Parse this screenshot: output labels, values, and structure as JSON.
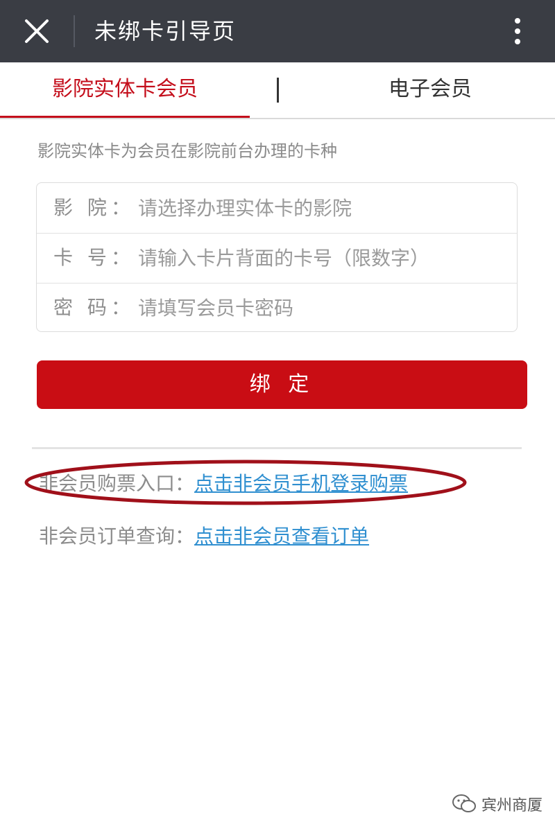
{
  "topbar": {
    "title": "未绑卡引导页",
    "close_icon": "close-icon",
    "more_icon": "more-vertical-icon"
  },
  "tabs": [
    {
      "label": "影院实体卡会员",
      "active": true
    },
    {
      "label": "电子会员",
      "active": false
    }
  ],
  "intro": "影院实体卡为会员在影院前台办理的卡种",
  "form": {
    "rows": [
      {
        "label": "影 院：",
        "placeholder": "请选择办理实体卡的影院"
      },
      {
        "label": "卡 号：",
        "placeholder": "请输入卡片背面的卡号（限数字）"
      },
      {
        "label": "密 码：",
        "placeholder": "请填写会员卡密码"
      }
    ]
  },
  "bind_button": "绑 定",
  "links": [
    {
      "prefix": "非会员购票入口：",
      "link": "点击非会员手机登录购票"
    },
    {
      "prefix": "非会员订单查询：",
      "link": "点击非会员查看订单"
    }
  ],
  "watermark": "宾州商厦",
  "colors": {
    "topbar": "#3a3d44",
    "accent_red": "#c90d14",
    "link_blue": "#2f8fd0",
    "annotation_ellipse": "#a0101a"
  }
}
